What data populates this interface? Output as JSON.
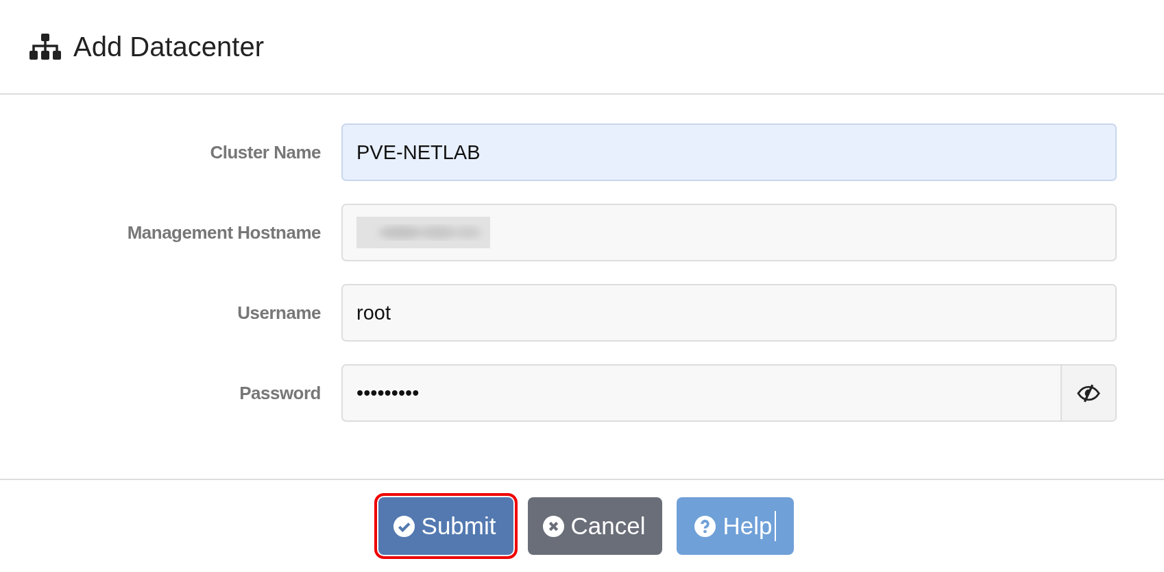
{
  "dialog": {
    "title": "Add Datacenter"
  },
  "fields": [
    {
      "label": "Cluster Name",
      "kind": "text",
      "value": "PVE-NETLAB",
      "autofilled": true
    },
    {
      "label": "Management Hostname",
      "kind": "redacted",
      "autofilled": false
    },
    {
      "label": "Username",
      "kind": "text",
      "value": "root",
      "autofilled": false
    },
    {
      "label": "Password",
      "kind": "password",
      "value": "•••••••••",
      "autofilled": false
    }
  ],
  "buttons": [
    {
      "label": "Submit",
      "kind": "submit",
      "highlighted": true,
      "text_cursor": false
    },
    {
      "label": "Cancel",
      "kind": "cancel",
      "highlighted": false,
      "text_cursor": false
    },
    {
      "label": "Help",
      "kind": "help",
      "highlighted": false,
      "text_cursor": true
    }
  ]
}
